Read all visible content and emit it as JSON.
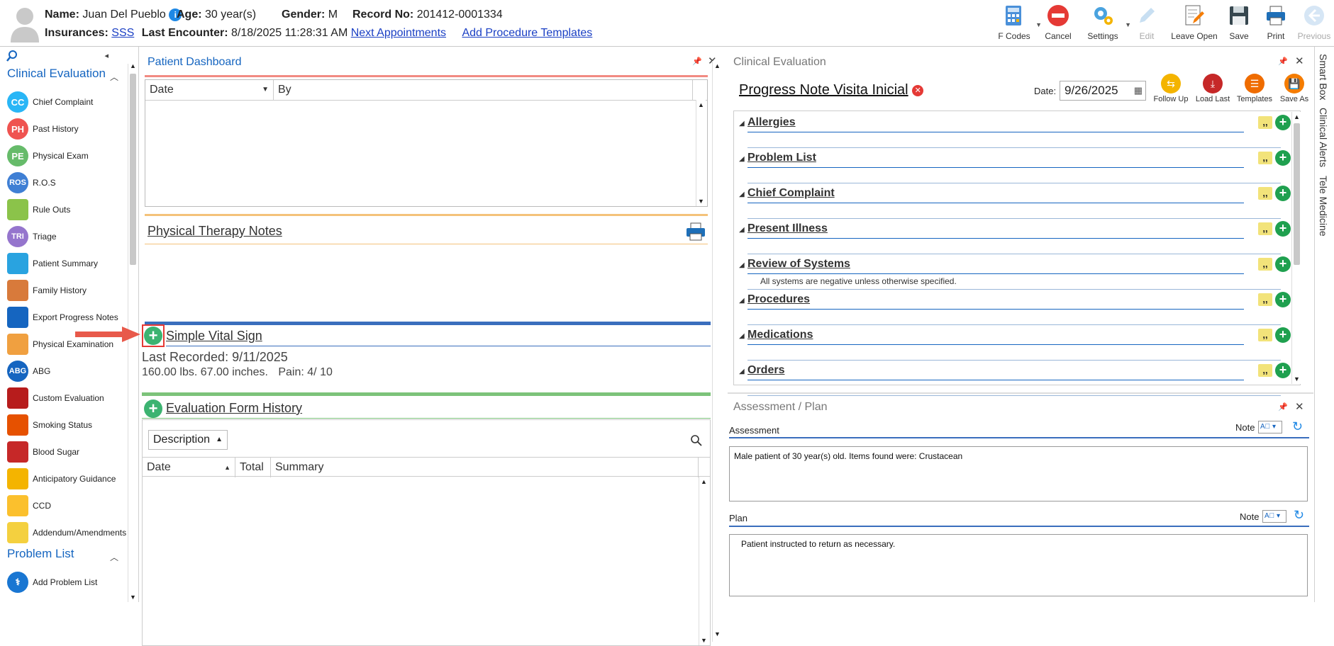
{
  "header": {
    "name_label": "Name:",
    "name": "Juan Del Pueblo",
    "age_label": "Age:",
    "age": "30 year(s)",
    "gender_label": "Gender:",
    "gender": "M",
    "record_label": "Record No:",
    "record": "201412-0001334",
    "insurances_label": "Insurances:",
    "insurance": "SSS",
    "last_encounter_label": "Last Encounter:",
    "last_encounter": "8/18/2025 11:28:31 AM",
    "next_appointments": "Next Appointments",
    "add_procedure_templates": "Add Procedure Templates"
  },
  "toolbar": {
    "f_codes": "F Codes",
    "cancel": "Cancel",
    "settings": "Settings",
    "edit": "Edit",
    "leave_open": "Leave Open",
    "save": "Save",
    "print": "Print",
    "previous": "Previous"
  },
  "leftnav": {
    "clinical_evaluation": "Clinical Evaluation",
    "problem_list": "Problem List",
    "items": [
      {
        "label": "Chief Complaint",
        "abbr": "CC",
        "color": "#29b6f6"
      },
      {
        "label": "Past History",
        "abbr": "PH",
        "color": "#ef5350"
      },
      {
        "label": "Physical Exam",
        "abbr": "PE",
        "color": "#66bb6a"
      },
      {
        "label": "R.O.S",
        "abbr": "ROS",
        "color": "#3f7fd4"
      },
      {
        "label": "Rule Outs",
        "abbr": "",
        "color": "#8bc34a"
      },
      {
        "label": "Triage",
        "abbr": "TRI",
        "color": "#9575cd"
      },
      {
        "label": "Patient Summary",
        "abbr": "",
        "color": "#29a3e0"
      },
      {
        "label": "Family History",
        "abbr": "",
        "color": "#d87a3b"
      },
      {
        "label": "Export Progress Notes",
        "abbr": "",
        "color": "#1565c0"
      },
      {
        "label": "Physical Examination",
        "abbr": "",
        "color": "#f0a040"
      },
      {
        "label": "ABG",
        "abbr": "ABG",
        "color": "#1565c0"
      },
      {
        "label": "Custom Evaluation",
        "abbr": "",
        "color": "#b71c1c"
      },
      {
        "label": "Smoking Status",
        "abbr": "",
        "color": "#e65100"
      },
      {
        "label": "Blood Sugar",
        "abbr": "",
        "color": "#c62828"
      },
      {
        "label": "Anticipatory Guidance",
        "abbr": "",
        "color": "#f4b400"
      },
      {
        "label": "CCD",
        "abbr": "",
        "color": "#fbc02d"
      },
      {
        "label": "Addendum/Amendments",
        "abbr": "",
        "color": "#f4d03f"
      }
    ],
    "problem_items": [
      {
        "label": "Add Problem List",
        "color": "#1976d2"
      }
    ]
  },
  "dashboard": {
    "title": "Patient Dashboard",
    "grid_cols": [
      "Date",
      "By"
    ],
    "physical_therapy_notes": "Physical Therapy Notes",
    "simple_vital_sign": "Simple Vital Sign",
    "last_recorded": "Last Recorded: 9/11/2025",
    "vitals_line": "160.00 lbs. 67.00 inches.",
    "pain": "Pain: 4/ 10",
    "evaluation_form_history": "Evaluation Form History",
    "description_select": "Description",
    "history_cols": [
      "Date",
      "Total",
      "Summary"
    ]
  },
  "clinical": {
    "title": "Clinical Evaluation",
    "note_title": "Progress Note Visita Inicial",
    "date_label": "Date:",
    "date_value": "9/26/2025",
    "actions": [
      "Follow Up",
      "Load Last",
      "Templates",
      "Save As"
    ],
    "sections": [
      {
        "title": "Allergies",
        "note": ""
      },
      {
        "title": "Problem List",
        "note": ""
      },
      {
        "title": "Chief Complaint",
        "note": ""
      },
      {
        "title": "Present Illness",
        "note": ""
      },
      {
        "title": "Review of Systems",
        "note": "All systems are negative unless otherwise specified."
      },
      {
        "title": "Procedures",
        "note": ""
      },
      {
        "title": "Medications",
        "note": ""
      },
      {
        "title": "Orders",
        "note": ""
      }
    ]
  },
  "assessment_plan": {
    "title": "Assessment / Plan",
    "assessment_label": "Assessment",
    "note_label": "Note",
    "assessment_text": "Male patient of 30 year(s) old. Items found were:  Crustacean",
    "plan_label": "Plan",
    "plan_text": "Patient instructed to return as necessary."
  },
  "side_tabs": [
    "Smart Box",
    "Clinical Alerts",
    "Tele Medicine"
  ]
}
